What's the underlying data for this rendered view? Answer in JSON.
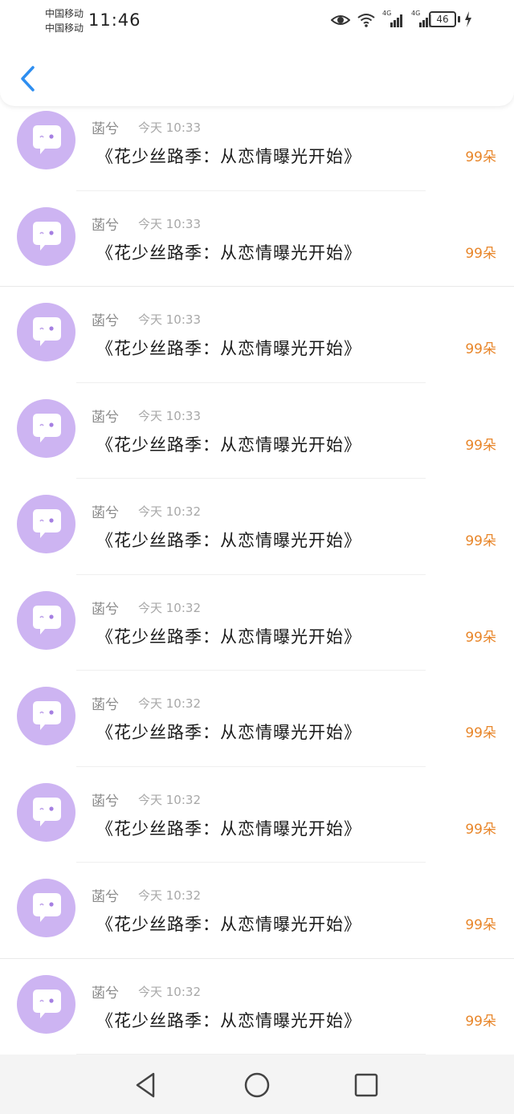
{
  "status_bar": {
    "carrier_1": "中国移动",
    "carrier_2": "中国移动",
    "time": "11:46",
    "network_1": "4G",
    "network_2": "4G",
    "battery": "46"
  },
  "colors": {
    "avatar": "#cdb4f2",
    "amount": "#e8862a",
    "back_arrow": "#2e8ef0"
  },
  "messages": [
    {
      "sender": "菡兮",
      "time": "今天 10:33",
      "title": "《花少丝路季：从恋情曝光开始》",
      "amount": "99朵"
    },
    {
      "sender": "菡兮",
      "time": "今天 10:33",
      "title": "《花少丝路季：从恋情曝光开始》",
      "amount": "99朵"
    },
    {
      "sender": "菡兮",
      "time": "今天 10:33",
      "title": "《花少丝路季：从恋情曝光开始》",
      "amount": "99朵"
    },
    {
      "sender": "菡兮",
      "time": "今天 10:33",
      "title": "《花少丝路季：从恋情曝光开始》",
      "amount": "99朵"
    },
    {
      "sender": "菡兮",
      "time": "今天 10:32",
      "title": "《花少丝路季：从恋情曝光开始》",
      "amount": "99朵"
    },
    {
      "sender": "菡兮",
      "time": "今天 10:32",
      "title": "《花少丝路季：从恋情曝光开始》",
      "amount": "99朵"
    },
    {
      "sender": "菡兮",
      "time": "今天 10:32",
      "title": "《花少丝路季：从恋情曝光开始》",
      "amount": "99朵"
    },
    {
      "sender": "菡兮",
      "time": "今天 10:32",
      "title": "《花少丝路季：从恋情曝光开始》",
      "amount": "99朵"
    },
    {
      "sender": "菡兮",
      "time": "今天 10:32",
      "title": "《花少丝路季：从恋情曝光开始》",
      "amount": "99朵"
    },
    {
      "sender": "菡兮",
      "time": "今天 10:32",
      "title": "《花少丝路季：从恋情曝光开始》",
      "amount": "99朵"
    }
  ]
}
